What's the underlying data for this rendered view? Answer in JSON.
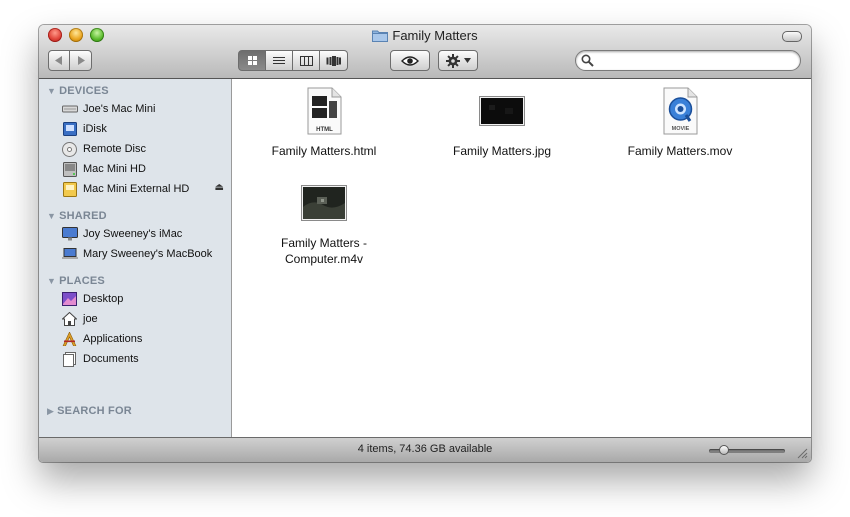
{
  "window": {
    "title": "Family Matters"
  },
  "toolbar": {
    "view_modes": [
      "icon-view",
      "list-view",
      "column-view",
      "cover-flow-view"
    ],
    "active_view": "icon-view"
  },
  "search": {
    "value": "",
    "placeholder": ""
  },
  "sidebar": {
    "sections": [
      {
        "heading": "DEVICES",
        "items": [
          {
            "label": "Joe's Mac Mini",
            "icon": "computer-icon"
          },
          {
            "label": "iDisk",
            "icon": "idisk-icon"
          },
          {
            "label": "Remote Disc",
            "icon": "disc-icon"
          },
          {
            "label": "Mac Mini HD",
            "icon": "hard-drive-icon"
          },
          {
            "label": "Mac Mini External HD",
            "icon": "external-drive-icon",
            "eject": true
          }
        ]
      },
      {
        "heading": "SHARED",
        "items": [
          {
            "label": "Joy Sweeney's iMac",
            "icon": "imac-icon"
          },
          {
            "label": "Mary Sweeney's MacBook",
            "icon": "laptop-icon"
          }
        ]
      },
      {
        "heading": "PLACES",
        "items": [
          {
            "label": "Desktop",
            "icon": "desktop-icon"
          },
          {
            "label": "joe",
            "icon": "home-icon"
          },
          {
            "label": "Applications",
            "icon": "applications-icon"
          },
          {
            "label": "Documents",
            "icon": "documents-icon"
          }
        ]
      },
      {
        "heading": "SEARCH FOR",
        "items": []
      }
    ]
  },
  "files": [
    {
      "name": "Family Matters.html",
      "icon": "html-file-icon",
      "badge": "HTML"
    },
    {
      "name": "Family Matters.jpg",
      "icon": "image-thumbnail-icon"
    },
    {
      "name": "Family Matters.mov",
      "icon": "quicktime-movie-icon",
      "badge": "MOVIE"
    },
    {
      "name": "Family Matters -\nComputer.m4v",
      "name_line1": "Family Matters -",
      "name_line2": "Computer.m4v",
      "icon": "video-thumbnail-icon"
    }
  ],
  "status": {
    "text": "4 items, 74.36 GB available",
    "zoom_level": 0.15
  }
}
